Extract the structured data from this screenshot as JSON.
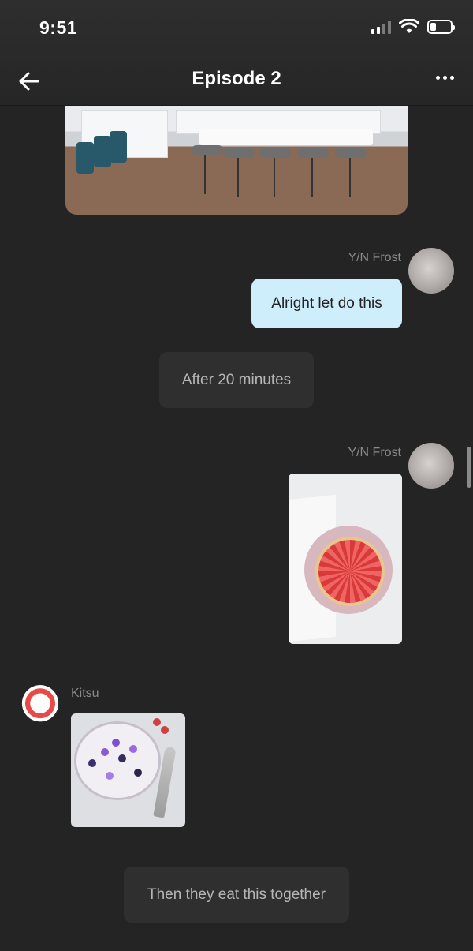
{
  "status_bar": {
    "time": "9:51",
    "signal_bars": 4,
    "signal_active_bars": 2,
    "battery_level": 0.3
  },
  "header": {
    "title": "Episode 2",
    "back_icon": "back-arrow-icon",
    "more_icon": "more-dots-icon"
  },
  "messages": [
    {
      "type": "image",
      "side": "right",
      "image": "kitchen-photo"
    },
    {
      "type": "text",
      "side": "right",
      "sender": "Y/N Frost",
      "text": "Alright let do this"
    },
    {
      "type": "narration",
      "text": "After 20 minutes"
    },
    {
      "type": "image",
      "side": "right",
      "sender": "Y/N Frost",
      "image": "strawberry-tart-photo"
    },
    {
      "type": "image",
      "side": "left",
      "sender": "Kitsu",
      "image": "berry-bowl-photo"
    },
    {
      "type": "narration",
      "text": "Then they eat this together"
    }
  ],
  "colors": {
    "background": "#242424",
    "outgoing_bubble": "#cfeefc",
    "narration_bubble": "#2f2f2f",
    "sender_name": "#8a8a8a"
  }
}
